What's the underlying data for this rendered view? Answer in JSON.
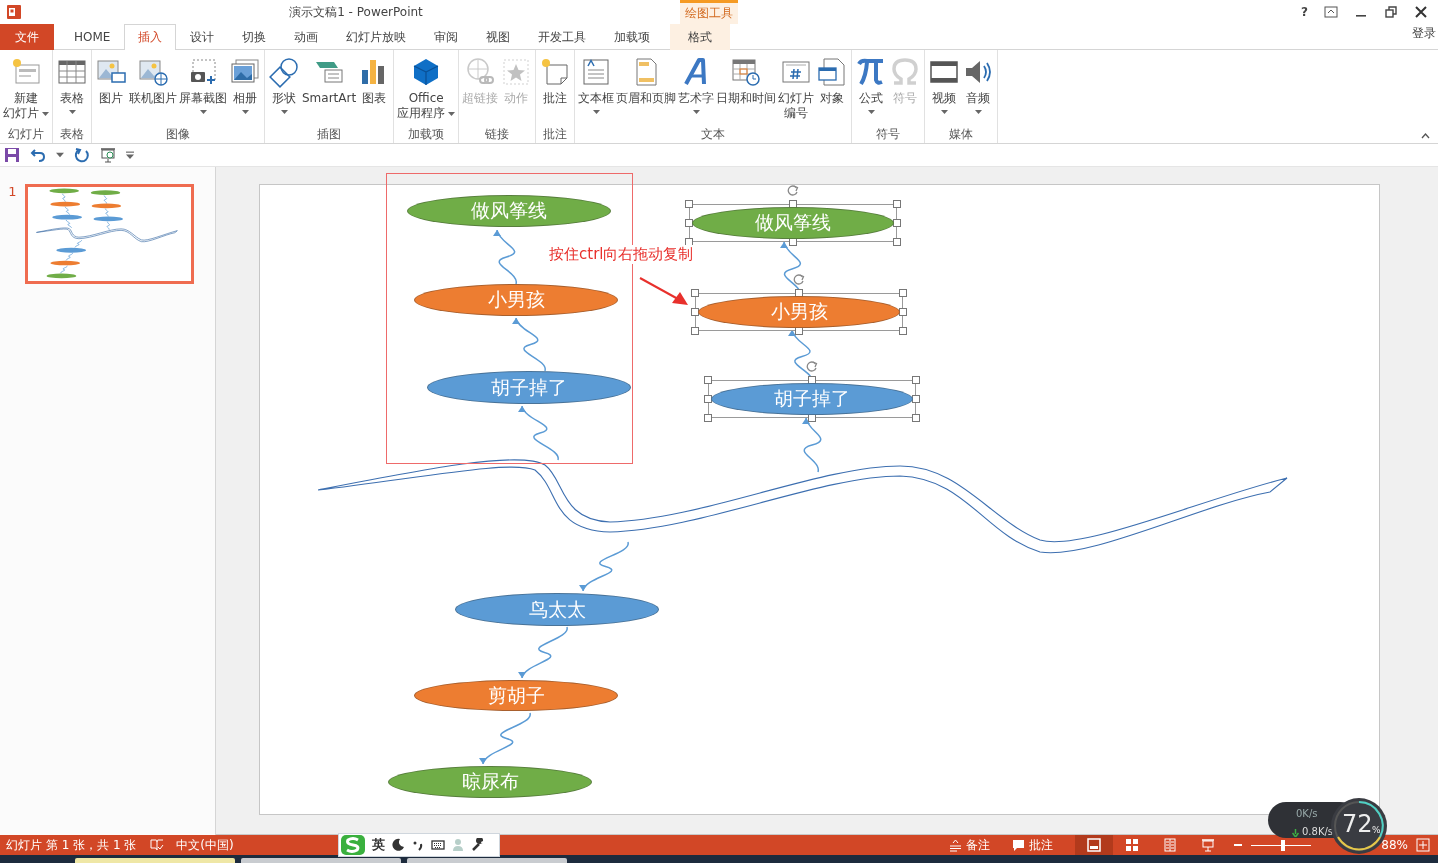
{
  "window": {
    "title": "演示文稿1 - PowerPoint",
    "contextual_header": "绘图工具",
    "help": "?",
    "signin": "登录"
  },
  "tabs": [
    {
      "label": "文件",
      "kind": "file",
      "selected": false
    },
    {
      "label": "HOME",
      "kind": "normal",
      "selected": false
    },
    {
      "label": "插入",
      "kind": "normal",
      "selected": true
    },
    {
      "label": "设计",
      "kind": "normal",
      "selected": false
    },
    {
      "label": "切换",
      "kind": "normal",
      "selected": false
    },
    {
      "label": "动画",
      "kind": "normal",
      "selected": false
    },
    {
      "label": "幻灯片放映",
      "kind": "normal",
      "selected": false
    },
    {
      "label": "审阅",
      "kind": "normal",
      "selected": false
    },
    {
      "label": "视图",
      "kind": "normal",
      "selected": false
    },
    {
      "label": "开发工具",
      "kind": "normal",
      "selected": false
    },
    {
      "label": "加载项",
      "kind": "normal",
      "selected": false
    },
    {
      "label": "格式",
      "kind": "contextual",
      "selected": false
    }
  ],
  "ribbon": {
    "groups": [
      {
        "label": "幻灯片",
        "buttons": [
          {
            "lines": [
              "新建",
              "幻灯片"
            ],
            "dropdown": true,
            "disabled": false
          }
        ]
      },
      {
        "label": "表格",
        "buttons": [
          {
            "label": "表格",
            "dropdown": true,
            "disabled": false
          }
        ]
      },
      {
        "label": "图像",
        "buttons": [
          {
            "label": "图片",
            "dropdown": false,
            "disabled": false
          },
          {
            "label": "联机图片",
            "dropdown": false,
            "disabled": false
          },
          {
            "label": "屏幕截图",
            "dropdown": true,
            "disabled": false
          },
          {
            "label": "相册",
            "dropdown": true,
            "disabled": false
          }
        ]
      },
      {
        "label": "插图",
        "buttons": [
          {
            "label": "形状",
            "dropdown": true,
            "disabled": false
          },
          {
            "label": "SmartArt",
            "dropdown": false,
            "disabled": false
          },
          {
            "label": "图表",
            "dropdown": false,
            "disabled": false
          }
        ]
      },
      {
        "label": "加载项",
        "buttons": [
          {
            "lines": [
              "Office",
              "应用程序"
            ],
            "dropdown": true,
            "disabled": false
          }
        ]
      },
      {
        "label": "链接",
        "buttons": [
          {
            "label": "超链接",
            "dropdown": false,
            "disabled": true
          },
          {
            "label": "动作",
            "dropdown": false,
            "disabled": true
          }
        ]
      },
      {
        "label": "批注",
        "buttons": [
          {
            "label": "批注",
            "dropdown": false,
            "disabled": false
          }
        ]
      },
      {
        "label": "文本",
        "buttons": [
          {
            "label": "文本框",
            "dropdown": true,
            "disabled": false
          },
          {
            "label": "页眉和页脚",
            "dropdown": false,
            "disabled": false
          },
          {
            "label": "艺术字",
            "dropdown": true,
            "disabled": false
          },
          {
            "label": "日期和时间",
            "dropdown": false,
            "disabled": false
          },
          {
            "lines": [
              "幻灯片",
              "编号"
            ],
            "dropdown": false,
            "disabled": false
          },
          {
            "label": "对象",
            "dropdown": false,
            "disabled": false
          }
        ]
      },
      {
        "label": "符号",
        "buttons": [
          {
            "label": "公式",
            "dropdown": true,
            "disabled": false
          },
          {
            "label": "符号",
            "dropdown": false,
            "disabled": true
          }
        ]
      },
      {
        "label": "媒体",
        "buttons": [
          {
            "label": "视频",
            "dropdown": true,
            "disabled": false
          },
          {
            "label": "音频",
            "dropdown": true,
            "disabled": false
          }
        ]
      }
    ]
  },
  "slides_pane": {
    "thumbnails": [
      {
        "number": "1",
        "selected": true
      }
    ]
  },
  "slide": {
    "annotation": "按住ctrl向右拖动复制",
    "nodes": [
      {
        "text": "做风筝线",
        "color": "#70ad47",
        "selected": false
      },
      {
        "text": "小男孩",
        "color": "#ed7d31",
        "selected": false
      },
      {
        "text": "胡子掉了",
        "color": "#5b9bd5",
        "selected": false
      },
      {
        "text": "做风筝线",
        "color": "#70ad47",
        "selected": true
      },
      {
        "text": "小男孩",
        "color": "#ed7d31",
        "selected": true
      },
      {
        "text": "胡子掉了",
        "color": "#5b9bd5",
        "selected": true
      },
      {
        "text": "鸟太太",
        "color": "#5b9bd5",
        "selected": false
      },
      {
        "text": "剪胡子",
        "color": "#ed7d31",
        "selected": false
      },
      {
        "text": "晾尿布",
        "color": "#70ad47",
        "selected": false
      }
    ]
  },
  "status_bar": {
    "slide_info": "幻灯片 第 1 张，共 1 张",
    "language": "中文(中国)",
    "ime_mode": "英",
    "notes": "备注",
    "comments": "批注",
    "views": [
      {
        "selected": true
      },
      {
        "selected": false
      },
      {
        "selected": false
      },
      {
        "selected": false
      }
    ],
    "zoom": {
      "level": 0.52,
      "reading": "88%"
    }
  },
  "network_widget": {
    "upload": "0K/s",
    "download": "0.8K/s",
    "percent": "72",
    "percent_sign": "%"
  }
}
